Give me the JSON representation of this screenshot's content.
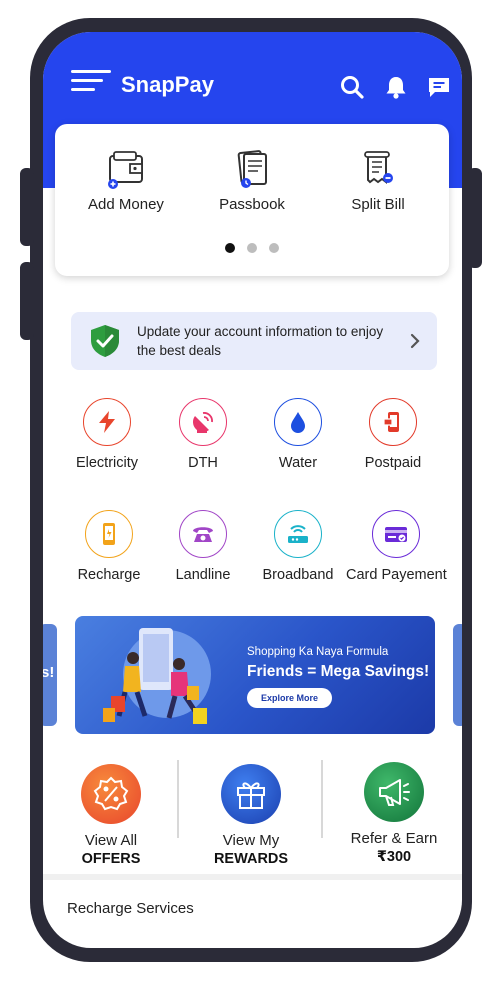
{
  "app": {
    "title": "SnapPay"
  },
  "header": {
    "icons": [
      "menu-icon",
      "search-icon",
      "bell-icon",
      "chat-icon"
    ]
  },
  "quick_actions": [
    {
      "label": "Add Money",
      "icon": "wallet-icon"
    },
    {
      "label": "Passbook",
      "icon": "passbook-icon"
    },
    {
      "label": "Split Bill",
      "icon": "split-bill-icon"
    }
  ],
  "carousel": {
    "pages": 3,
    "active": 1
  },
  "update_banner": {
    "text": "Update your account information to enjoy the best deals",
    "icon": "shield-check-icon"
  },
  "services_row1": [
    {
      "label": "Electricity",
      "icon": "bolt-icon",
      "color": "#e8452c"
    },
    {
      "label": "DTH",
      "icon": "satellite-dish-icon",
      "color": "#e8366b"
    },
    {
      "label": "Water",
      "icon": "water-drop-icon",
      "color": "#1d4fe0"
    },
    {
      "label": "Postpaid",
      "icon": "postpaid-phone-icon",
      "color": "#e23a2a"
    }
  ],
  "services_row2": [
    {
      "label": "Recharge",
      "icon": "mobile-icon",
      "color": "#f2a31a"
    },
    {
      "label": "Landline",
      "icon": "landline-icon",
      "color": "#a146c7"
    },
    {
      "label": "Broadband",
      "icon": "router-icon",
      "color": "#1ab2c9"
    },
    {
      "label": "Card Payement",
      "icon": "card-icon",
      "color": "#6a2bd8"
    }
  ],
  "promo_banner": {
    "subtitle": "Shopping Ka Naya Formula",
    "title": "Friends = Mega Savings!",
    "button": "Explore More",
    "left_peek_text": "s!"
  },
  "offers": [
    {
      "line1": "View All",
      "line2": "OFFERS",
      "icon": "percent-badge-icon",
      "color": "#f0552a"
    },
    {
      "line1": "View My",
      "line2": "REWARDS",
      "icon": "gift-icon",
      "color": "#1e56d8"
    },
    {
      "line1": "Refer & Earn",
      "line2": "₹300",
      "icon": "megaphone-icon",
      "color": "#1d9a4a"
    }
  ],
  "sections": {
    "recharge_title": "Recharge Services"
  },
  "colors": {
    "primary": "#2545ee",
    "phone_frame": "#2b2b38"
  }
}
